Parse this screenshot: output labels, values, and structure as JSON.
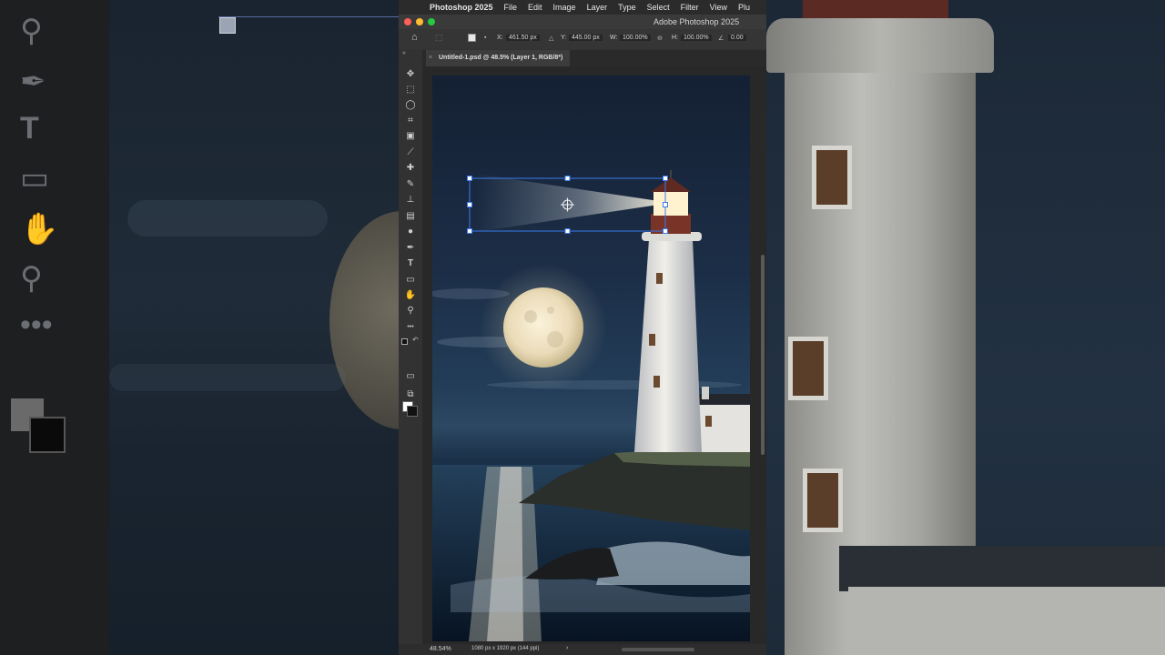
{
  "menubar": {
    "app_name": "Photoshop 2025",
    "items": [
      "File",
      "Edit",
      "Image",
      "Layer",
      "Type",
      "Select",
      "Filter",
      "View",
      "Plu"
    ]
  },
  "window": {
    "title": "Adobe Photoshop 2025"
  },
  "options_bar": {
    "x_label": "X:",
    "x_value": "461.50 px",
    "y_label": "Y:",
    "y_value": "445.00 px",
    "w_label": "W:",
    "w_value": "100.00%",
    "h_label": "H:",
    "h_value": "100.00%",
    "angle_value": "0.00"
  },
  "document_tab": {
    "label": "Untitled-1.psd @ 48.5% (Layer 1, RGB/8*)",
    "close": "×"
  },
  "status_bar": {
    "zoom": "48.54%",
    "doc_info": "1080 px x 1920 px (144 ppi)",
    "arrow": "›"
  },
  "tools": [
    {
      "icon": "move-icon",
      "glyph": "✥"
    },
    {
      "icon": "marquee-icon",
      "glyph": "⬚"
    },
    {
      "icon": "lasso-icon",
      "glyph": "◯"
    },
    {
      "icon": "crop-icon",
      "glyph": "⌗"
    },
    {
      "icon": "object-select-icon",
      "glyph": "▣"
    },
    {
      "icon": "eyedropper-icon",
      "glyph": "⟋"
    },
    {
      "icon": "healing-brush-icon",
      "glyph": "✚"
    },
    {
      "icon": "brush-icon",
      "glyph": "✎"
    },
    {
      "icon": "clone-stamp-icon",
      "glyph": "⊥"
    },
    {
      "icon": "gradient-icon",
      "glyph": "▤"
    },
    {
      "icon": "dodge-icon",
      "glyph": "●"
    },
    {
      "icon": "pen-icon",
      "glyph": "✒"
    },
    {
      "icon": "type-icon",
      "glyph": "T"
    },
    {
      "icon": "rectangle-icon",
      "glyph": "▭"
    },
    {
      "icon": "hand-icon",
      "glyph": "✋"
    },
    {
      "icon": "zoom-icon",
      "glyph": "⚲"
    },
    {
      "icon": "more-tools-icon",
      "glyph": "•••"
    }
  ],
  "colors": {
    "menubar_bg": "#2b2b2b",
    "panel_bg": "#323232",
    "selection_blue": "#2f6fe0",
    "moon": "#efe3c6"
  }
}
